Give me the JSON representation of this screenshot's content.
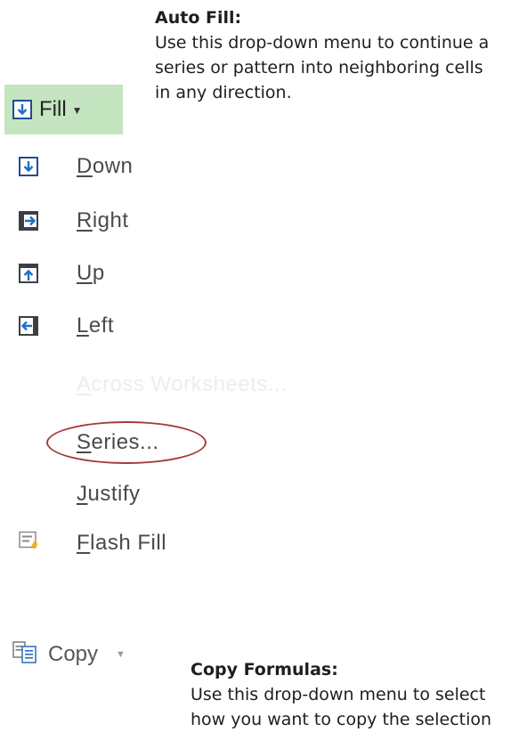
{
  "autofill_callout": {
    "title": "Auto Fill:",
    "body": "Use this drop-down menu to continue a\nseries or pattern into neighboring cells\nin any direction."
  },
  "fill_button": {
    "label": "Fill",
    "icon": "fill-down-icon",
    "accent": "#c5e5c0"
  },
  "menu": {
    "down": {
      "mnemonic": "D",
      "rest": "own",
      "icon": "arrow-down-icon"
    },
    "right": {
      "mnemonic": "R",
      "rest": "ight",
      "icon": "arrow-right-icon"
    },
    "up": {
      "mnemonic": "U",
      "rest": "p",
      "icon": "arrow-up-icon"
    },
    "left": {
      "mnemonic": "L",
      "rest": "eft",
      "icon": "arrow-left-icon"
    },
    "across": {
      "mnemonic": "A",
      "rest": "cross Worksheets...",
      "enabled": false
    },
    "series": {
      "mnemonic": "S",
      "rest": "eries...",
      "highlight_color": "#a23c3c"
    },
    "justify": {
      "mnemonic": "J",
      "rest": "ustify"
    },
    "flash": {
      "mnemonic": "F",
      "rest": "lash Fill",
      "icon": "flash-fill-icon"
    }
  },
  "copy_button": {
    "label": "Copy",
    "icon": "copy-icon"
  },
  "copy_callout": {
    "title": "Copy Formulas:",
    "body": "Use this drop-down menu to select\nhow you want to copy the selection"
  }
}
